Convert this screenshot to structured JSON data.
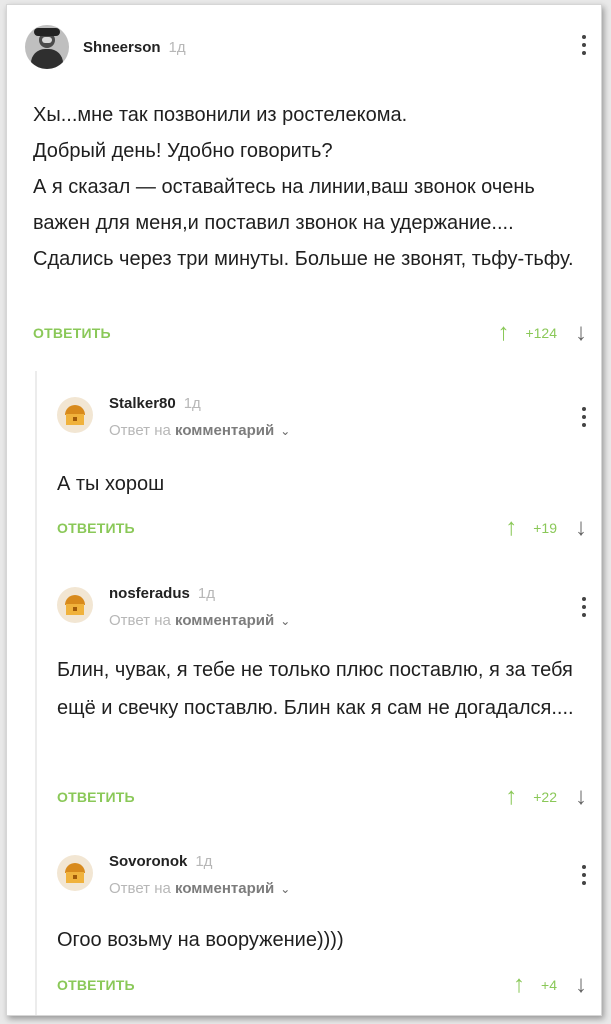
{
  "root": {
    "username": "Shneerson",
    "time": "1д",
    "text": "Хы...мне так позвонили из ростелекома.\nДобрый день! Удобно говорить?\nА я сказал — оставайтесь на линии,ваш звонок очень важен для меня,и поставил звонок на удержание.... Сдались через три минуты. Больше не звонят, тьфу-тьфу.",
    "reply_label": "ОТВЕТИТЬ",
    "score": "+124"
  },
  "replies": [
    {
      "username": "Stalker80",
      "time": "1д",
      "reply_prefix": "Ответ на",
      "reply_target": "комментарий",
      "text": "А ты хорош",
      "reply_label": "ОТВЕТИТЬ",
      "score": "+19"
    },
    {
      "username": "nosferadus",
      "time": "1д",
      "reply_prefix": "Ответ на",
      "reply_target": "комментарий",
      "text": "Блин, чувак, я тебе не только плюс поставлю, я за тебя ещё и свечку поставлю. Блин как я сам не догадался....",
      "reply_label": "ОТВЕТИТЬ",
      "score": "+22"
    },
    {
      "username": "Sovoronok",
      "time": "1д",
      "reply_prefix": "Ответ на",
      "reply_target": "комментарий",
      "text": "Огоо возьму на вооружение))))",
      "reply_label": "ОТВЕТИТЬ",
      "score": "+4"
    }
  ],
  "icons": {
    "upvote": "up-arrow",
    "downvote": "down-arrow",
    "menu": "vertical-ellipsis",
    "chevron": "chevron-down"
  },
  "colors": {
    "accent_green": "#8ac858",
    "muted_gray": "#b7b7b7"
  }
}
